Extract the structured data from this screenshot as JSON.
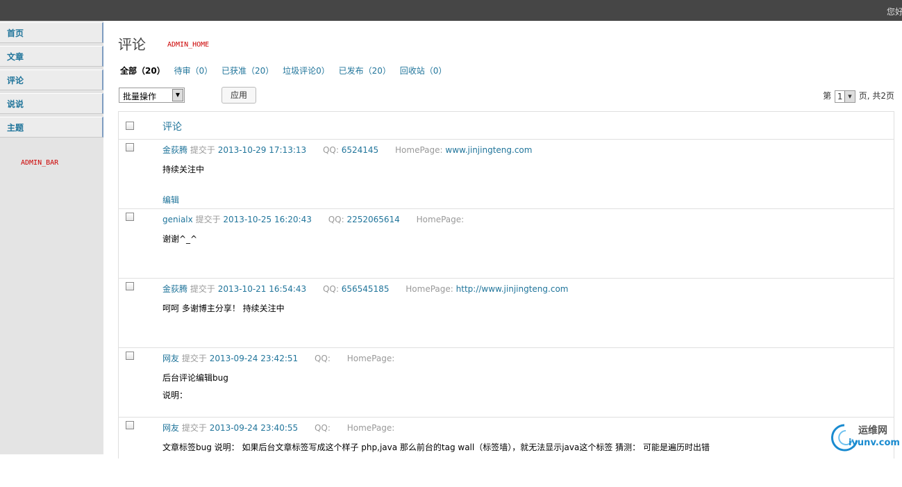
{
  "topbar": {
    "greeting": "您好"
  },
  "sidebar": {
    "items": [
      {
        "label": "首页"
      },
      {
        "label": "文章"
      },
      {
        "label": "评论"
      },
      {
        "label": "说说"
      },
      {
        "label": "主题"
      }
    ],
    "placeholder": "ADMIN_BAR"
  },
  "header": {
    "title": "评论",
    "placeholder": "ADMIN_HOME"
  },
  "filters": [
    {
      "label": "全部（20）"
    },
    {
      "label": "待审（0）"
    },
    {
      "label": "已获准（20）"
    },
    {
      "label": "垃圾评论0）"
    },
    {
      "label": "已发布（20）"
    },
    {
      "label": "回收站（0）"
    }
  ],
  "toolbar": {
    "bulk_label": "批量操作",
    "apply_label": "应用"
  },
  "pager": {
    "prefix": "第",
    "current": "1",
    "suffix": "页, 共2页"
  },
  "table": {
    "column_title": "评论",
    "rows": [
      {
        "author": "金荻腾",
        "submitted": "提交于",
        "date": "2013-10-29 17:13:13",
        "qq_label": "QQ:",
        "qq": "6524145",
        "hp_label": "HomePage:",
        "homepage": "www.jinjingteng.com",
        "lines": [
          "持续关注中"
        ],
        "edit": "编辑"
      },
      {
        "author": "genialx",
        "submitted": "提交于",
        "date": "2013-10-25 16:20:43",
        "qq_label": "QQ:",
        "qq": "2252065614",
        "hp_label": "HomePage:",
        "homepage": "",
        "lines": [
          "谢谢^_^"
        ]
      },
      {
        "author": "金荻腾",
        "submitted": "提交于",
        "date": "2013-10-21 16:54:43",
        "qq_label": "QQ:",
        "qq": "656545185",
        "hp_label": "HomePage:",
        "homepage": "http://www.jinjingteng.com",
        "lines": [
          "呵呵 多谢博主分享！ 持续关注中"
        ]
      },
      {
        "author": "网友",
        "submitted": "提交于",
        "date": "2013-09-24 23:42:51",
        "qq_label": "QQ:",
        "qq": "",
        "hp_label": "HomePage:",
        "homepage": "",
        "lines": [
          "后台评论编辑bug",
          "说明："
        ]
      },
      {
        "author": "网友",
        "submitted": "提交于",
        "date": "2013-09-24 23:40:55",
        "qq_label": "QQ:",
        "qq": "",
        "hp_label": "HomePage:",
        "homepage": "",
        "lines": [
          "文章标签bug 说明： 如果后台文章标签写成这个样子 php,java 那么前台的tag wall（标签墙），就无法显示java这个标签 猜测： 可能是遍历时出错"
        ]
      }
    ]
  },
  "watermark": {
    "top": "运维网",
    "bottom": "iyunv.com"
  }
}
